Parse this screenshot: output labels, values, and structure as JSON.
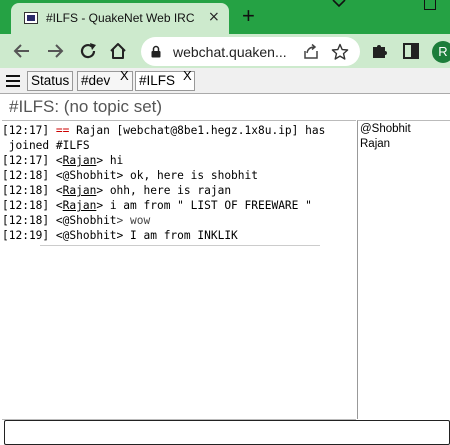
{
  "browser": {
    "tab_title": "#ILFS - QuakeNet Web IRC",
    "tab_close": "×",
    "new_tab": "+",
    "url": "webchat.quaken...",
    "profile_initial": "R",
    "theme_color": "#25a244",
    "toolbar_color": "#cdeacd"
  },
  "irc": {
    "tabs": [
      {
        "label": "Status"
      },
      {
        "label": "#dev",
        "close": "X"
      },
      {
        "label": "#ILFS",
        "close": "X"
      }
    ],
    "topic": "#ILFS: (no topic set)",
    "messages": [
      {
        "time": "[12:17]",
        "text": "== Rajan [webchat@8be1.hegz.1x8u.ip] has"
      },
      {
        "text": " joined #ILFS"
      },
      {
        "time": "[12:17]",
        "prefix": "<",
        "nick": "Rajan",
        "suffix": "> hi"
      },
      {
        "time": "[12:18]",
        "prefix": "<",
        "nick": "@Shobhit",
        "suffix": "> ok, here is shobhit"
      },
      {
        "time": "[12:18]",
        "prefix": "<",
        "nick": "Rajan",
        "suffix": "> ohh, here is rajan"
      },
      {
        "time": "[12:18]",
        "prefix": "<",
        "nick": "Rajan",
        "suffix": "> i am from \" LIST OF FREEWARE \""
      },
      {
        "time": "[12:18]",
        "prefix": "<",
        "nick": "@Shobhit",
        "suffix": "> wow"
      },
      {
        "time": "[12:19]",
        "prefix": "<",
        "nick": "@Shobhit",
        "suffix": "> I am from INKLIK"
      }
    ],
    "nicklist": [
      "@Shobhit",
      "Rajan"
    ],
    "colors": {
      "join": "#c00000"
    }
  }
}
